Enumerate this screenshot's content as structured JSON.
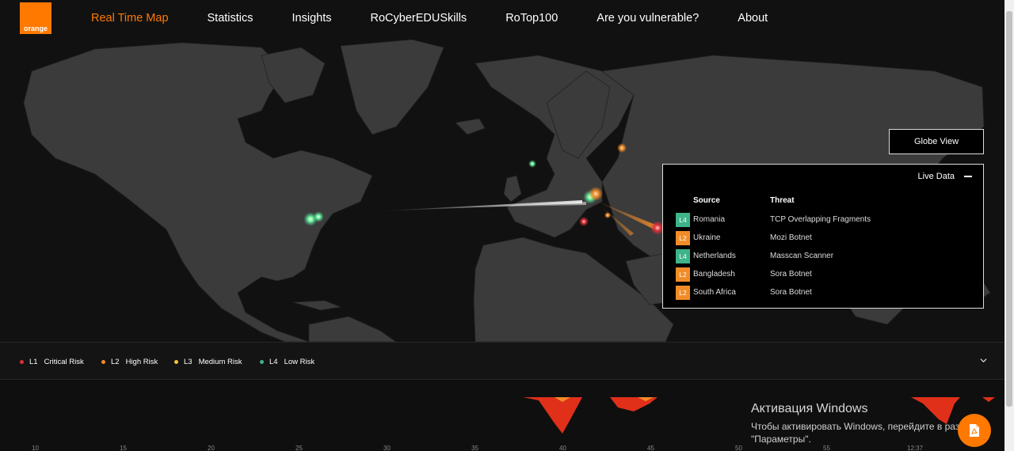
{
  "header": {
    "logo_text": "orange",
    "nav": [
      "Real Time Map",
      "Statistics",
      "Insights",
      "RoCyberEDUSkills",
      "RoTop100",
      "Are you vulnerable?",
      "About"
    ],
    "active_index": 0
  },
  "map": {
    "globe_view_label": "Globe View",
    "live_data": {
      "title": "Live Data",
      "source_header": "Source",
      "threat_header": "Threat",
      "rows": [
        {
          "level": "L4",
          "source": "Romania",
          "threat": "TCP Overlapping Fragments",
          "color": "#3eb489"
        },
        {
          "level": "L2",
          "source": "Ukraine",
          "threat": "Mozi Botnet",
          "color": "#f28c28"
        },
        {
          "level": "L4",
          "source": "Netherlands",
          "threat": "Masscan Scanner",
          "color": "#3eb489"
        },
        {
          "level": "L2",
          "source": "Bangladesh",
          "threat": "Sora Botnet",
          "color": "#f28c28"
        },
        {
          "level": "L2",
          "source": "South Africa",
          "threat": "Sora Botnet",
          "color": "#f28c28"
        }
      ]
    }
  },
  "legend": [
    {
      "level": "L1",
      "label": "Critical Risk",
      "color": "#e0303a"
    },
    {
      "level": "L2",
      "label": "High Risk",
      "color": "#f28c28"
    },
    {
      "level": "L3",
      "label": "Medium Risk",
      "color": "#f5c242"
    },
    {
      "level": "L4",
      "label": "Low Risk",
      "color": "#3eb489"
    }
  ],
  "timeline": {
    "ticks": [
      "10",
      "15",
      "20",
      "25",
      "30",
      "35",
      "40",
      "45",
      "50",
      "55",
      "12:37"
    ]
  },
  "watermark": {
    "title": "Активация Windows",
    "line1": "Чтобы активировать Windows, перейдите в разд",
    "line2": "\"Параметры\"."
  },
  "colors": {
    "accent": "#ff7900",
    "background": "#111111",
    "land": "#3b3b3b"
  },
  "icons": {
    "minimize": "minus-icon",
    "expand": "chevron-down-icon",
    "report": "pdf-icon"
  }
}
